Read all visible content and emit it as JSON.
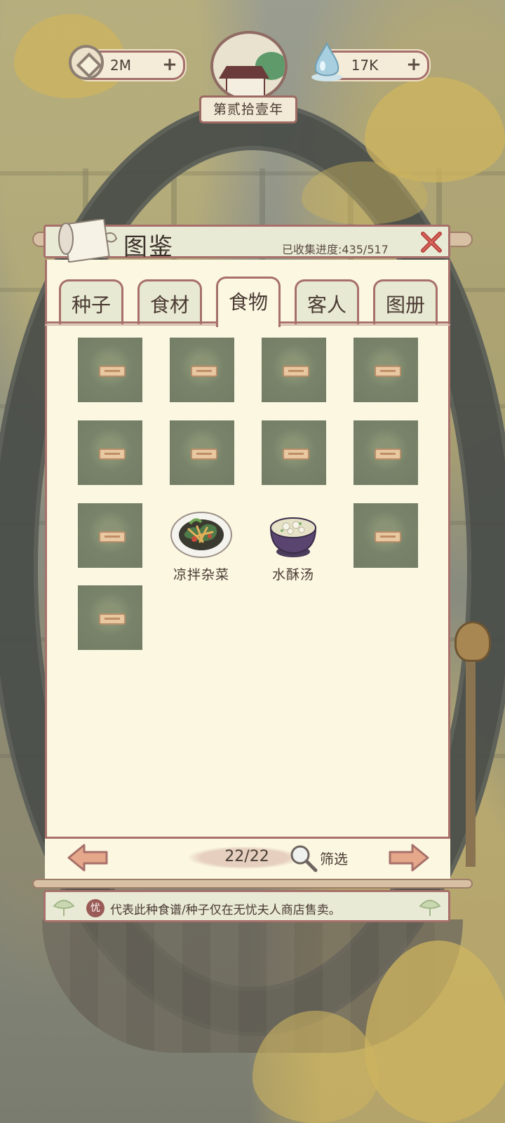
{
  "hud": {
    "coins": "2M",
    "spirit": "17K",
    "year": "第贰拾壹年"
  },
  "panel": {
    "title": "图鉴",
    "progress": "已收集进度:435/517"
  },
  "tabs": [
    {
      "label": "种子",
      "active": false
    },
    {
      "label": "食材",
      "active": false
    },
    {
      "label": "食物",
      "active": true
    },
    {
      "label": "客人",
      "active": false
    },
    {
      "label": "图册",
      "active": false
    }
  ],
  "foods": [
    {
      "name": "凉拌杂菜"
    },
    {
      "name": "水酥汤"
    }
  ],
  "pagination": {
    "page": "22/22",
    "filter_label": "筛选"
  },
  "notice": {
    "badge": "忧",
    "text": "代表此种食谱/种子仅在无忧夫人商店售卖。"
  },
  "colors": {
    "panel_border": "#a7706a",
    "paper": "#fbf7e1",
    "locked_slot": "#78836a"
  }
}
